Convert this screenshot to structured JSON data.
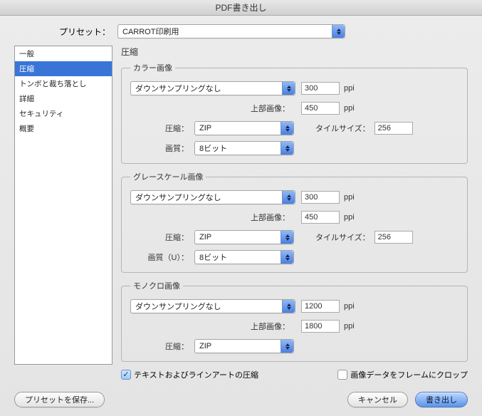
{
  "window": {
    "title": "PDF書き出し"
  },
  "preset": {
    "label": "プリセット：",
    "value": "CARROT印刷用"
  },
  "sidebar": {
    "items": [
      {
        "label": "一般"
      },
      {
        "label": "圧縮"
      },
      {
        "label": "トンボと裁ち落とし"
      },
      {
        "label": "詳細"
      },
      {
        "label": "セキュリティ"
      },
      {
        "label": "概要"
      }
    ],
    "selected_index": 1
  },
  "section": {
    "title": "圧縮"
  },
  "color": {
    "legend": "カラー画像",
    "downsample": "ダウンサンプリングなし",
    "ppi": "300",
    "above_label": "上部画像：",
    "above_ppi": "450",
    "compress_label": "圧縮：",
    "compress_value": "ZIP",
    "tile_label": "タイルサイズ：",
    "tile_value": "256",
    "quality_label": "画質：",
    "quality_value": "8ビット",
    "ppi_unit": "ppi"
  },
  "gray": {
    "legend": "グレースケール画像",
    "downsample": "ダウンサンプリングなし",
    "ppi": "300",
    "above_label": "上部画像：",
    "above_ppi": "450",
    "compress_label": "圧縮：",
    "compress_value": "ZIP",
    "tile_label": "タイルサイズ：",
    "tile_value": "256",
    "quality_label": "画質（U）：",
    "quality_value": "8ビット",
    "ppi_unit": "ppi"
  },
  "mono": {
    "legend": "モノクロ画像",
    "downsample": "ダウンサンプリングなし",
    "ppi": "1200",
    "above_label": "上部画像：",
    "above_ppi": "1800",
    "compress_label": "圧縮：",
    "compress_value": "ZIP",
    "ppi_unit": "ppi"
  },
  "checks": {
    "text_lineart": "テキストおよびラインアートの圧縮",
    "crop": "画像データをフレームにクロップ"
  },
  "footer": {
    "save_preset": "プリセットを保存...",
    "cancel": "キャンセル",
    "export": "書き出し"
  }
}
